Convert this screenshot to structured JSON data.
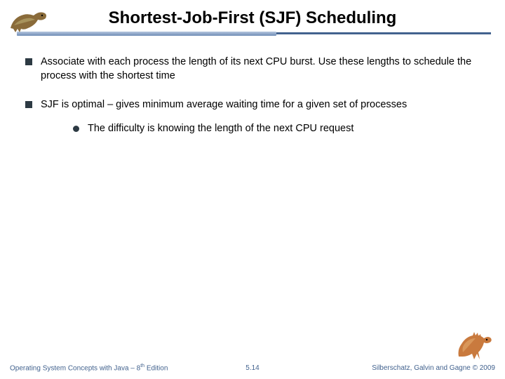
{
  "title": "Shortest-Job-First (SJF) Scheduling",
  "bullets": [
    {
      "text": "Associate with each process the length of its next CPU burst.  Use these lengths to schedule the process with the shortest time"
    },
    {
      "text": "SJF is optimal – gives minimum average waiting time for a given set of processes",
      "sub": "The difficulty is knowing the length of the next CPU request"
    }
  ],
  "footer": {
    "left_prefix": "Operating System Concepts with Java – 8",
    "left_suffix": " Edition",
    "center": "5.14",
    "right": "Silberschatz, Galvin and Gagne © 2009"
  }
}
